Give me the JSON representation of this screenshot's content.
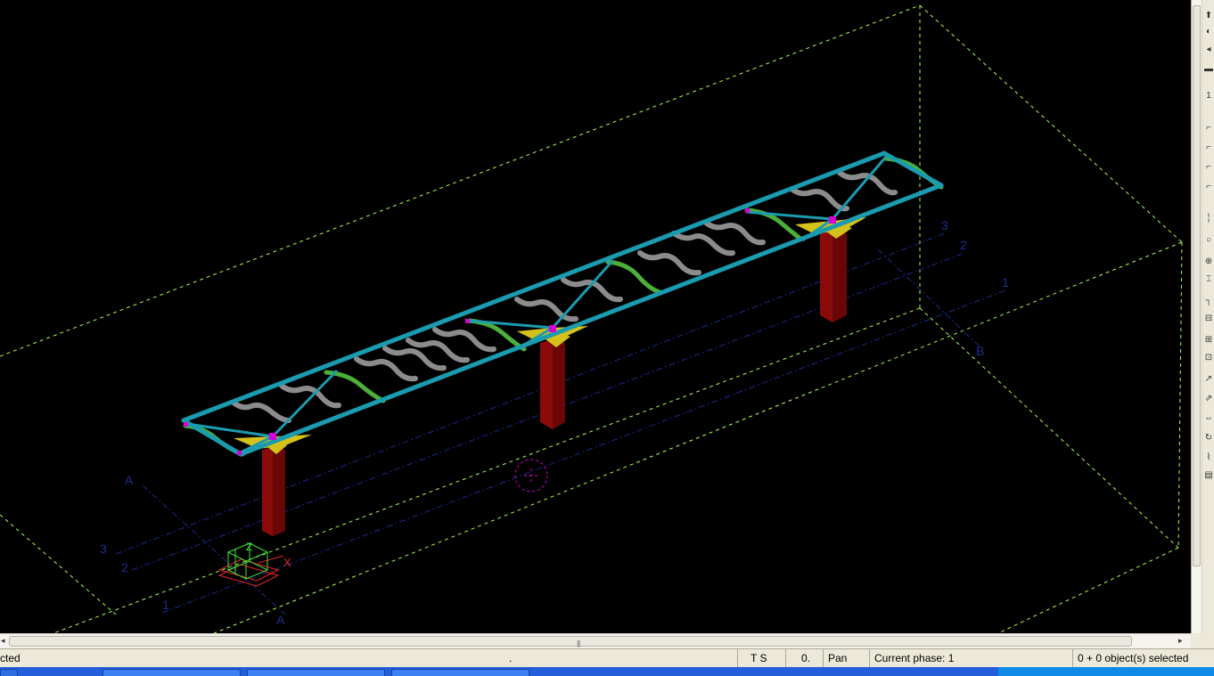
{
  "viewport": {
    "grid_labels": {
      "row_3_right": "3",
      "row_2_right": "2",
      "row_1_right": "1",
      "col_b": "B",
      "col_a_top": "A",
      "col_a_bottom": "A",
      "row_3_left": "3",
      "row_2_left": "2",
      "row_1_left": "1"
    },
    "axis_labels": {
      "x": "X",
      "z": "Z"
    },
    "colors": {
      "background": "#000000",
      "workarea_box": "#a8ff50",
      "grid": "#1a2a8a",
      "grid_label": "#1b2d8f",
      "beam": "#1a9bb0",
      "rib_gray": "#8c8c8c",
      "rib_green": "#4caf3a",
      "column": "#8b0a0a",
      "bearing": "#d4c21a",
      "node": "#d400d4",
      "axis": "#e8242a"
    }
  },
  "hscroll": {
    "grip": "|||",
    "left_arrow": "◂",
    "right_arrow": "▸"
  },
  "status": {
    "prompt": "cted",
    "dot": ".",
    "snap": "T S",
    "value": "0.",
    "mode": "Pan",
    "phase": "Current phase: 1",
    "selection": "0 + 0 object(s) selected"
  },
  "toolbar_icons": [
    "pointer-icon",
    "magnet-icon",
    "arrow-left-icon",
    "arrow-right-icon",
    "line-icon",
    "number-icon",
    "snap-icon",
    "snap-icon",
    "snap-icon",
    "snap-icon",
    "grid-icon",
    "node-icon",
    "part-icon",
    "bolt-icon",
    "weld-icon",
    "cut-icon",
    "fitting-icon",
    "measure-icon",
    "copy-icon",
    "move-icon",
    "mirror-icon",
    "rotate-icon",
    "rebar-icon",
    "hatch-icon"
  ]
}
